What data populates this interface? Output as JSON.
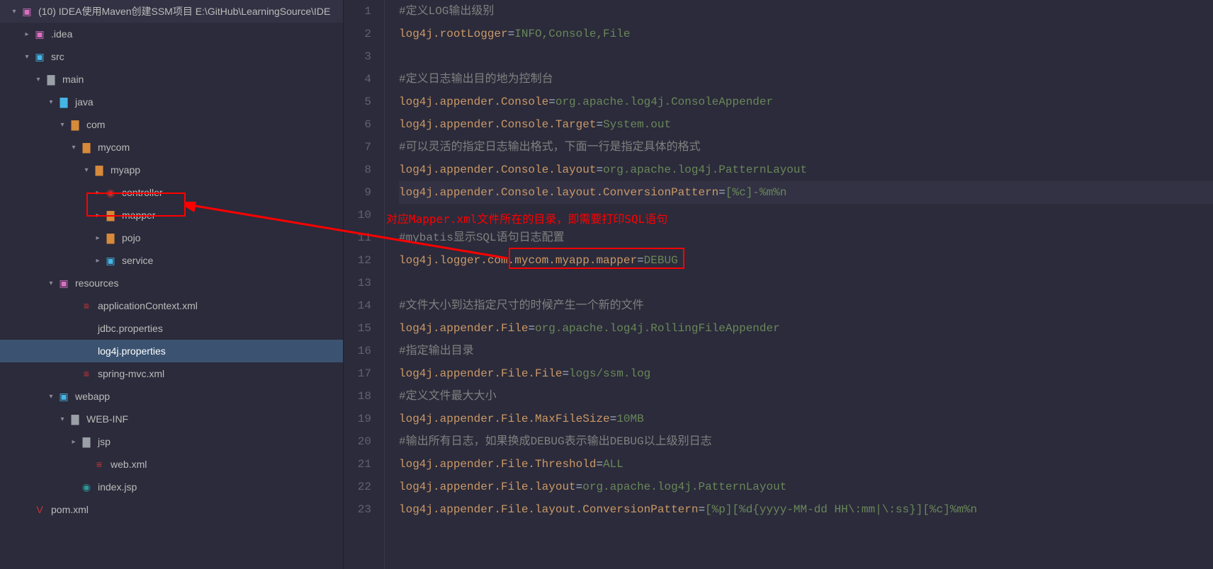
{
  "tree": {
    "root": "(10) IDEA使用Maven创建SSM项目  E:\\GitHub\\LearningSource\\IDE",
    "items": [
      {
        "indent": 1,
        "chev": ">",
        "icon": "idea",
        "label": ".idea",
        "color": "pink"
      },
      {
        "indent": 1,
        "chev": "v",
        "icon": "src",
        "label": "src",
        "color": "blue"
      },
      {
        "indent": 2,
        "chev": "v",
        "icon": "folder",
        "label": "main",
        "color": "gray"
      },
      {
        "indent": 3,
        "chev": "v",
        "icon": "folder-blue",
        "label": "java",
        "color": "blue"
      },
      {
        "indent": 4,
        "chev": "v",
        "icon": "folder-orange",
        "label": "com",
        "color": "orange"
      },
      {
        "indent": 5,
        "chev": "v",
        "icon": "folder-orange",
        "label": "mycom",
        "color": "orange"
      },
      {
        "indent": 6,
        "chev": "v",
        "icon": "folder-orange",
        "label": "myapp",
        "color": "orange"
      },
      {
        "indent": 7,
        "chev": ">",
        "icon": "controller",
        "label": "controller",
        "color": "",
        "hl": false
      },
      {
        "indent": 7,
        "chev": ">",
        "icon": "folder-orange",
        "label": "mapper",
        "color": "orange",
        "hl": true
      },
      {
        "indent": 7,
        "chev": ">",
        "icon": "folder-orange",
        "label": "pojo",
        "color": "orange"
      },
      {
        "indent": 7,
        "chev": ">",
        "icon": "service",
        "label": "service",
        "color": "blue"
      },
      {
        "indent": 3,
        "chev": "v",
        "icon": "resources",
        "label": "resources",
        "color": "pink"
      },
      {
        "indent": 5,
        "chev": "",
        "icon": "xml",
        "label": "applicationContext.xml",
        "color": ""
      },
      {
        "indent": 5,
        "chev": "",
        "icon": "prop",
        "label": "jdbc.properties",
        "color": ""
      },
      {
        "indent": 5,
        "chev": "",
        "icon": "prop",
        "label": "log4j.properties",
        "color": "",
        "selected": true
      },
      {
        "indent": 5,
        "chev": "",
        "icon": "xml",
        "label": "spring-mvc.xml",
        "color": ""
      },
      {
        "indent": 3,
        "chev": "v",
        "icon": "webapp",
        "label": "webapp",
        "color": "blue"
      },
      {
        "indent": 4,
        "chev": "v",
        "icon": "folder",
        "label": "WEB-INF",
        "color": "gray"
      },
      {
        "indent": 5,
        "chev": ">",
        "icon": "folder",
        "label": "jsp",
        "color": "gray"
      },
      {
        "indent": 6,
        "chev": "",
        "icon": "xml",
        "label": "web.xml",
        "color": ""
      },
      {
        "indent": 5,
        "chev": "",
        "icon": "jsp",
        "label": "index.jsp",
        "color": ""
      },
      {
        "indent": 1,
        "chev": "",
        "icon": "maven",
        "label": "pom.xml",
        "color": ""
      }
    ]
  },
  "annotation": "对应Mapper.xml文件所在的目录，即需要打印SQL语句",
  "code": [
    {
      "n": 1,
      "segs": [
        [
          "c-comment",
          "#定义LOG输出级别"
        ]
      ]
    },
    {
      "n": 2,
      "segs": [
        [
          "c-key",
          "log4j.rootLogger"
        ],
        [
          "",
          "="
        ],
        [
          "c-val",
          "INFO,Console,File"
        ]
      ]
    },
    {
      "n": 3,
      "segs": [
        [
          "",
          ""
        ]
      ]
    },
    {
      "n": 4,
      "segs": [
        [
          "c-comment",
          "#定义日志输出目的地为控制台"
        ]
      ]
    },
    {
      "n": 5,
      "segs": [
        [
          "c-key",
          "log4j.appender.Console"
        ],
        [
          "",
          "="
        ],
        [
          "c-val",
          "org.apache.log4j.ConsoleAppender"
        ]
      ]
    },
    {
      "n": 6,
      "segs": [
        [
          "c-key",
          "log4j.appender.Console.Target"
        ],
        [
          "",
          "="
        ],
        [
          "c-val",
          "System.out"
        ]
      ]
    },
    {
      "n": 7,
      "segs": [
        [
          "c-comment",
          "#可以灵活的指定日志输出格式，下面一行是指定具体的格式"
        ]
      ]
    },
    {
      "n": 8,
      "segs": [
        [
          "c-key",
          "log4j.appender.Console.layout"
        ],
        [
          "",
          "="
        ],
        [
          "c-val",
          "org.apache.log4j.PatternLayout"
        ]
      ]
    },
    {
      "n": 9,
      "segs": [
        [
          "c-key",
          "log4j.appender.Console.layout.ConversionPattern"
        ],
        [
          "",
          "="
        ],
        [
          "c-val",
          "[%c]-%m%n"
        ]
      ],
      "current": true
    },
    {
      "n": 10,
      "segs": [
        [
          "",
          ""
        ]
      ]
    },
    {
      "n": 11,
      "segs": [
        [
          "c-comment",
          "#mybatis显示SQL语句日志配置"
        ]
      ]
    },
    {
      "n": 12,
      "segs": [
        [
          "c-key",
          "log4j.logger."
        ],
        [
          "c-key u",
          "com.mycom.myapp.mapper"
        ],
        [
          "",
          "="
        ],
        [
          "c-val",
          "DEBUG"
        ]
      ]
    },
    {
      "n": 13,
      "segs": [
        [
          "",
          ""
        ]
      ]
    },
    {
      "n": 14,
      "segs": [
        [
          "c-comment",
          "#文件大小到达指定尺寸的时候产生一个新的文件"
        ]
      ]
    },
    {
      "n": 15,
      "segs": [
        [
          "c-key",
          "log4j.appender.File"
        ],
        [
          "",
          "="
        ],
        [
          "c-val",
          "org.apache.log4j.RollingFileAppender"
        ]
      ]
    },
    {
      "n": 16,
      "segs": [
        [
          "c-comment",
          "#指定输出目录"
        ]
      ]
    },
    {
      "n": 17,
      "segs": [
        [
          "c-key",
          "log4j.appender.File.File"
        ],
        [
          "",
          "="
        ],
        [
          "c-val",
          "logs/ssm.log"
        ]
      ]
    },
    {
      "n": 18,
      "segs": [
        [
          "c-comment",
          "#定义文件最大大小"
        ]
      ]
    },
    {
      "n": 19,
      "segs": [
        [
          "c-key",
          "log4j.appender.File.MaxFileSize"
        ],
        [
          "",
          "="
        ],
        [
          "c-val",
          "10MB"
        ]
      ]
    },
    {
      "n": 20,
      "segs": [
        [
          "c-comment",
          "#输出所有日志，如果换成DEBUG表示输出DEBUG以上级别日志"
        ]
      ]
    },
    {
      "n": 21,
      "segs": [
        [
          "c-key",
          "log4j.appender.File.Threshold"
        ],
        [
          "",
          "="
        ],
        [
          "c-val",
          "ALL"
        ]
      ]
    },
    {
      "n": 22,
      "segs": [
        [
          "c-key",
          "log4j.appender.File.layout"
        ],
        [
          "",
          "="
        ],
        [
          "c-val",
          "org.apache.log4j.PatternLayout"
        ]
      ]
    },
    {
      "n": 23,
      "segs": [
        [
          "c-key",
          "log4j.appender.File.layout.ConversionPattern"
        ],
        [
          "",
          "="
        ],
        [
          "c-val",
          "[%p][%d{yyyy-MM-dd HH\\:mm|\\:ss}][%c]%m%n"
        ]
      ]
    }
  ]
}
